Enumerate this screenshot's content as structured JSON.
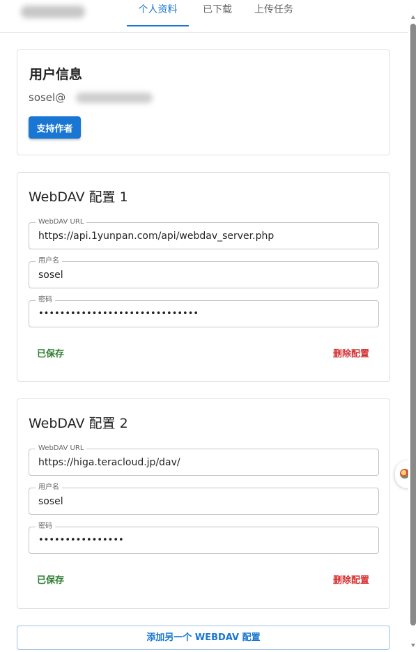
{
  "header": {
    "tabs": [
      {
        "label": "个人资料",
        "active": true
      },
      {
        "label": "已下载",
        "active": false
      },
      {
        "label": "上传任务",
        "active": false
      }
    ]
  },
  "user_card": {
    "title": "用户信息",
    "email_visible": "sosel@",
    "support_button": "支持作者"
  },
  "webdav_configs": [
    {
      "title": "WebDAV 配置 1",
      "url_label": "WebDAV URL",
      "url_value": "https://api.1yunpan.com/api/webdav_server.php",
      "user_label": "用户名",
      "user_value": "sosel",
      "password_label": "密码",
      "password_value": "••••••••••••••••••••••••••••••",
      "status": "已保存",
      "delete_label": "删除配置"
    },
    {
      "title": "WebDAV 配置 2",
      "url_label": "WebDAV URL",
      "url_value": "https://higa.teracloud.jp/dav/",
      "user_label": "用户名",
      "user_value": "sosel",
      "password_label": "密码",
      "password_value": "••••••••••••••••",
      "status": "已保存",
      "delete_label": "删除配置"
    }
  ],
  "add_button": "添加另一个 WEBDAV 配置",
  "colors": {
    "accent": "#1976d2",
    "saved": "#2e7d32",
    "delete": "#d32f2f"
  }
}
